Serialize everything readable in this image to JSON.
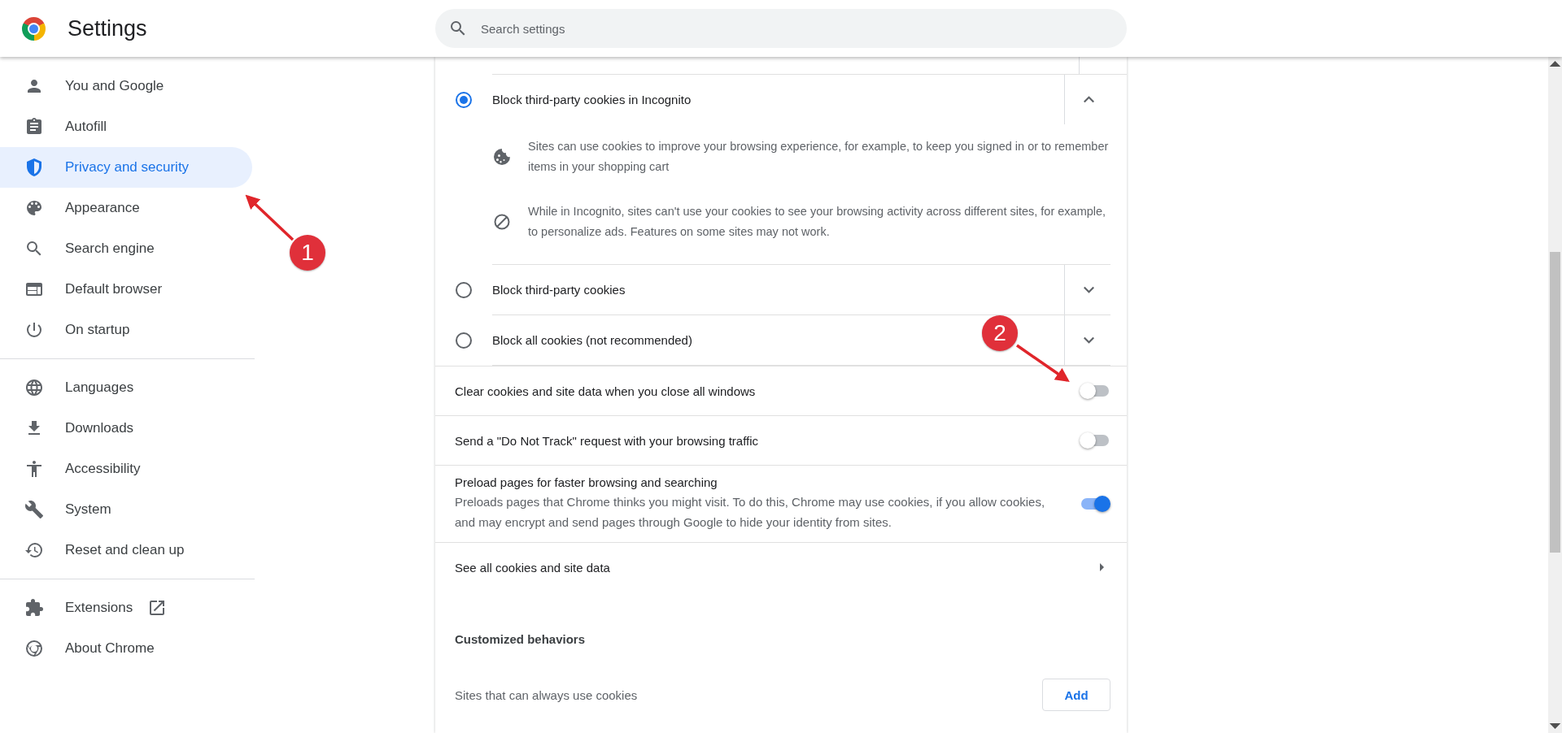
{
  "header": {
    "title": "Settings",
    "search": {
      "placeholder": "Search settings"
    }
  },
  "sidebar": {
    "groups": [
      [
        {
          "label": "You and Google",
          "selected": false,
          "kind": "link"
        },
        {
          "label": "Autofill",
          "selected": false,
          "kind": "link"
        },
        {
          "label": "Privacy and security",
          "selected": true,
          "kind": "link"
        },
        {
          "label": "Appearance",
          "selected": false,
          "kind": "link"
        },
        {
          "label": "Search engine",
          "selected": false,
          "kind": "link"
        },
        {
          "label": "Default browser",
          "selected": false,
          "kind": "link"
        },
        {
          "label": "On startup",
          "selected": false,
          "kind": "link"
        }
      ],
      [
        {
          "label": "Languages",
          "selected": false,
          "kind": "link"
        },
        {
          "label": "Downloads",
          "selected": false,
          "kind": "link"
        },
        {
          "label": "Accessibility",
          "selected": false,
          "kind": "link"
        },
        {
          "label": "System",
          "selected": false,
          "kind": "link"
        },
        {
          "label": "Reset and clean up",
          "selected": false,
          "kind": "link"
        }
      ],
      [
        {
          "label": "Extensions",
          "selected": false,
          "kind": "external"
        },
        {
          "label": "About Chrome",
          "selected": false,
          "kind": "link"
        }
      ]
    ]
  },
  "cookie_options": [
    {
      "label": "Block third-party cookies in Incognito",
      "selected": true,
      "expanded": true,
      "details": [
        "Sites can use cookies to improve your browsing experience, for example, to keep you signed in or to remember items in your shopping cart",
        "While in Incognito, sites can't use your cookies to see your browsing activity across different sites, for example, to personalize ads. Features on some sites may not work."
      ]
    },
    {
      "label": "Block third-party cookies",
      "selected": false,
      "expanded": false
    },
    {
      "label": "Block all cookies (not recommended)",
      "selected": false,
      "expanded": false
    }
  ],
  "toggles": [
    {
      "label": "Clear cookies and site data when you close all windows",
      "on": false
    },
    {
      "label": "Send a \"Do Not Track\" request with your browsing traffic",
      "on": false
    },
    {
      "label": "Preload pages for faster browsing and searching",
      "description": "Preloads pages that Chrome thinks you might visit. To do this, Chrome may use cookies, if you allow cookies, and may encrypt and send pages through Google to hide your identity from sites.",
      "on": true
    }
  ],
  "link_row": {
    "label": "See all cookies and site data"
  },
  "customized": {
    "heading": "Customized behaviors",
    "rows": [
      {
        "label": "Sites that can always use cookies",
        "button": "Add"
      }
    ]
  },
  "annotations": [
    {
      "label": "1"
    },
    {
      "label": "2"
    }
  ]
}
